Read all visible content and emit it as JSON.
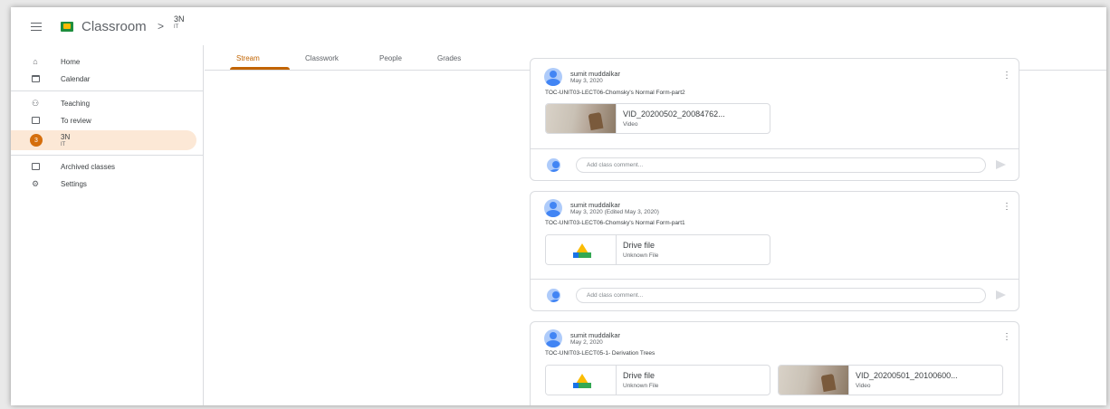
{
  "header": {
    "menu_icon": "menu-icon",
    "app_name": "Classroom",
    "separator": ">",
    "class_name": "3N",
    "class_section": "IT"
  },
  "sidebar": {
    "items": [
      {
        "label": "Home",
        "icon": "home-icon"
      },
      {
        "label": "Calendar",
        "icon": "calendar-icon"
      },
      {
        "label": "Teaching",
        "icon": "people-icon"
      },
      {
        "label": "To review",
        "icon": "review-icon"
      },
      {
        "label": "3N",
        "sub": "IT",
        "badge": "3"
      },
      {
        "label": "Archived classes",
        "icon": "archive-icon"
      },
      {
        "label": "Settings",
        "icon": "gear-icon"
      }
    ]
  },
  "tabs": [
    "Stream",
    "Classwork",
    "People",
    "Grades"
  ],
  "posts": [
    {
      "author": "sumit muddalkar",
      "date": "May 3, 2020",
      "title": "TOC-UNIT03-LECT06-Chomsky's Normal Form-part2",
      "attachments": [
        {
          "title": "VID_20200502_20084762...",
          "subtitle": "Video"
        }
      ],
      "comment_placeholder": "Add class comment..."
    },
    {
      "author": "sumit muddalkar",
      "date": "May 3, 2020 (Edited May 3, 2020)",
      "title": "TOC-UNIT03-LECT06-Chomsky's Normal Form-part1",
      "attachments": [
        {
          "title": "Drive file",
          "subtitle": "Unknown File"
        }
      ],
      "comment_placeholder": "Add class comment..."
    },
    {
      "author": "sumit muddalkar",
      "date": "May 2, 2020",
      "title": "TOC-UNIT03-LECT05-1- Derivation Trees",
      "attachments": [
        {
          "title": "Drive file",
          "subtitle": "Unknown File"
        },
        {
          "title": "VID_20200501_20100600...",
          "subtitle": "Video"
        }
      ]
    }
  ],
  "colors": {
    "accent": "#c26401",
    "badge": "#d56e0c",
    "active_bg": "#fce8d6"
  }
}
